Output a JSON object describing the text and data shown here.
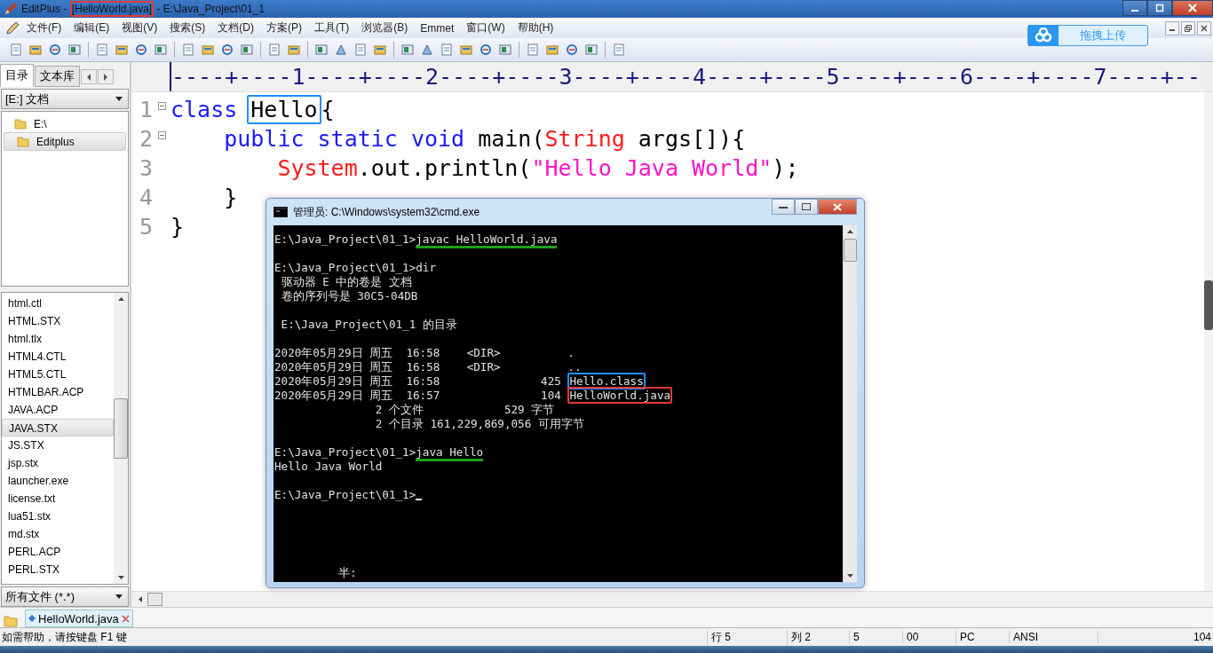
{
  "window": {
    "title_parts": [
      {
        "text": "EditPlus - "
      },
      {
        "text": "[HelloWorld.java]",
        "boxed": true,
        "color": "#e53935"
      },
      {
        "text": " - E:\\Java_Project\\01_1"
      }
    ]
  },
  "menu": [
    "文件(F)",
    "编辑(E)",
    "视图(V)",
    "搜索(S)",
    "文档(D)",
    "方案(P)",
    "工具(T)",
    "浏览器(B)",
    "Emmet",
    "窗口(W)",
    "帮助(H)"
  ],
  "upload_button": {
    "label": "拖拽上传"
  },
  "sidebar": {
    "tabs": [
      {
        "label": "目录",
        "selected": true
      },
      {
        "label": "文本库",
        "selected": false
      }
    ],
    "drive": "[E:] 文档",
    "folders": [
      {
        "name": "E:\\",
        "selected": false,
        "children": [
          {
            "name": "Editplus",
            "selected": true
          }
        ]
      }
    ],
    "files": [
      {
        "name": "html.ctl",
        "selected": false
      },
      {
        "name": "HTML.STX",
        "selected": false
      },
      {
        "name": "html.tlx",
        "selected": false
      },
      {
        "name": "HTML4.CTL",
        "selected": false
      },
      {
        "name": "HTML5.CTL",
        "selected": false
      },
      {
        "name": "HTMLBAR.ACP",
        "selected": false
      },
      {
        "name": "JAVA.ACP",
        "selected": false
      },
      {
        "name": "JAVA.STX",
        "selected": true
      },
      {
        "name": "JS.STX",
        "selected": false
      },
      {
        "name": "jsp.stx",
        "selected": false
      },
      {
        "name": "launcher.exe",
        "selected": false
      },
      {
        "name": "license.txt",
        "selected": false
      },
      {
        "name": "lua51.stx",
        "selected": false
      },
      {
        "name": "md.stx",
        "selected": false
      },
      {
        "name": "PERL.ACP",
        "selected": false
      },
      {
        "name": "PERL.STX",
        "selected": false
      }
    ],
    "filter": "所有文件 (*.*)"
  },
  "editor": {
    "ruler": "----+----1----+----2----+----3----+----4----+----5----+----6----+----7----+--",
    "lines": [
      {
        "number": "1",
        "foldable": true,
        "tokens": [
          {
            "kind": "keyword",
            "text": "class "
          },
          {
            "kind": "plain",
            "text": "Hello",
            "boxed": true,
            "color": "#1e90ff"
          },
          {
            "kind": "plain",
            "text": "{"
          }
        ]
      },
      {
        "number": "2",
        "foldable": true,
        "tokens": [
          {
            "kind": "keyword",
            "text": "    public static void "
          },
          {
            "kind": "plain",
            "text": "main("
          },
          {
            "kind": "type",
            "text": "String"
          },
          {
            "kind": "plain",
            "text": " args[]){"
          }
        ]
      },
      {
        "number": "3",
        "foldable": false,
        "tokens": [
          {
            "kind": "type",
            "text": "        System"
          },
          {
            "kind": "plain",
            "text": ".out.println("
          },
          {
            "kind": "string",
            "text": "\"Hello Java World\""
          },
          {
            "kind": "plain",
            "text": ");"
          }
        ]
      },
      {
        "number": "4",
        "foldable": false,
        "tokens": [
          {
            "kind": "plain",
            "text": "    }"
          }
        ]
      },
      {
        "number": "5",
        "foldable": false,
        "tokens": [
          {
            "kind": "plain",
            "text": "}"
          }
        ]
      }
    ]
  },
  "console": {
    "title": "管理员: C:\\Windows\\system32\\cmd.exe",
    "blocks": [
      [
        [
          {
            "text": "E:\\Java_Project\\01_1>"
          },
          {
            "text": "javac HelloWorld.java",
            "underlined": true,
            "color": "#1ea01e"
          }
        ]
      ],
      [
        [
          {
            "text": "E:\\Java_Project\\01_1>dir"
          }
        ],
        [
          {
            "text": " 驱动器 E 中的卷是 文档"
          }
        ],
        [
          {
            "text": " 卷的序列号是 30C5-04DB"
          }
        ]
      ],
      [
        [
          {
            "text": " E:\\Java_Project\\01_1 的目录"
          }
        ]
      ],
      [
        [
          {
            "text": "2020年05月29日 周五  16:58    <DIR>          ."
          }
        ],
        [
          {
            "text": "2020年05月29日 周五  16:58    <DIR>          .."
          }
        ],
        [
          {
            "text": "2020年05月29日 周五  16:58               425 "
          },
          {
            "text": "Hello.class",
            "boxed": true,
            "color": "#1e90ff"
          }
        ],
        [
          {
            "text": "2020年05月29日 周五  16:57               104 "
          },
          {
            "text": "HelloWorld.java",
            "boxed": true,
            "color": "#e53935"
          }
        ],
        [
          {
            "text": "               2 个文件            529 字节"
          }
        ],
        [
          {
            "text": "               2 个目录 161,229,869,056 可用字节"
          }
        ]
      ],
      [
        [
          {
            "text": "E:\\Java_Project\\01_1>"
          },
          {
            "text": "java Hello",
            "underlined": true,
            "color": "#1ea01e"
          }
        ],
        [
          {
            "text": "Hello Java World"
          }
        ]
      ],
      [
        [
          {
            "text": "E:\\Java_Project\\01_1>"
          }
        ]
      ]
    ],
    "ime_status": "半:"
  },
  "document_tabs": [
    {
      "label": "HelloWorld.java",
      "selected": true
    }
  ],
  "status_bar": {
    "help": "如需帮助，请按键盘 F1 键",
    "fields": [
      "行 5",
      "列 2",
      "5",
      "00",
      "PC",
      "ANSI",
      "104"
    ]
  }
}
